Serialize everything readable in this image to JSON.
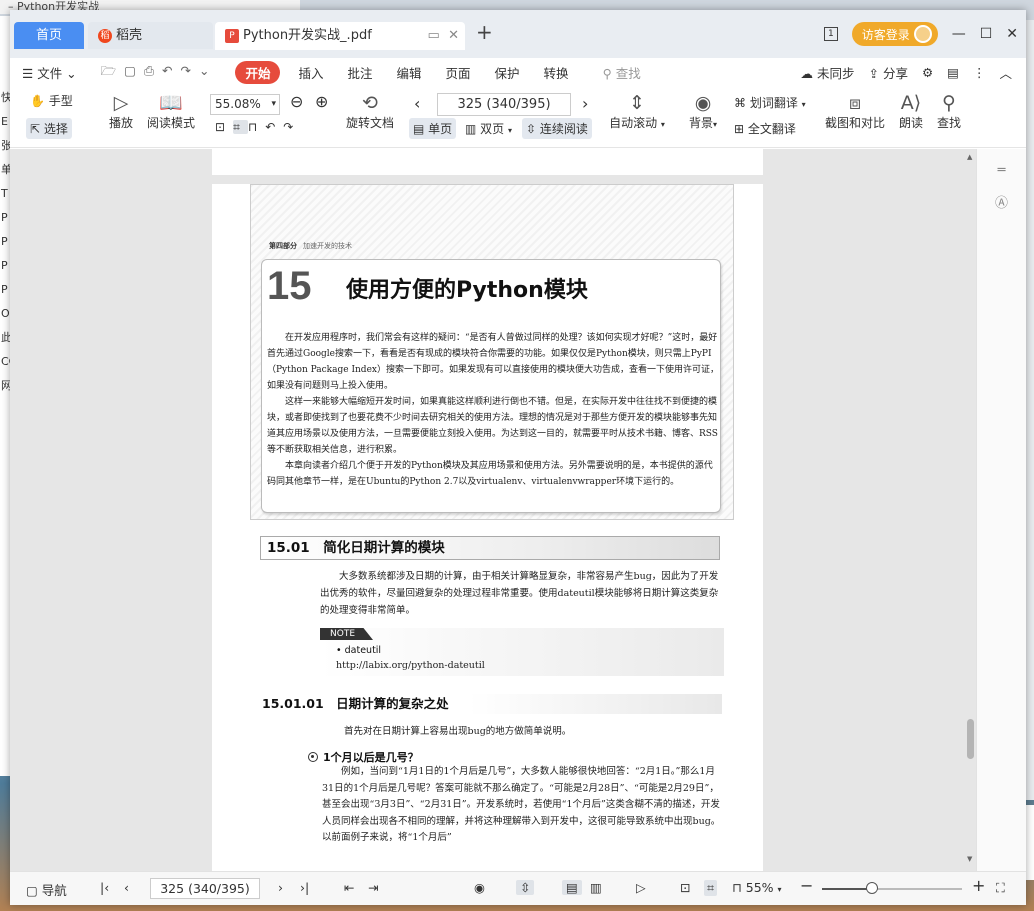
{
  "desktop": {
    "behind_title": "– Python开发实战",
    "behind_strip": [
      "快",
      "E",
      "张",
      "单",
      "T",
      "P",
      "P",
      "P",
      "P",
      "Or",
      "此",
      "CC",
      "网"
    ],
    "right_more": "···"
  },
  "tabs": {
    "home": "首页",
    "daoke": "稻壳",
    "pdf": "Python开发实战_.pdf",
    "add": "+"
  },
  "titlebar": {
    "page_indicator": "1",
    "login": "访客登录",
    "minimize": "—",
    "maximize": "☐",
    "close": "✕"
  },
  "menu": {
    "file": "文件",
    "start": "开始",
    "insert": "插入",
    "annotate": "批注",
    "edit": "编辑",
    "page": "页面",
    "protect": "保护",
    "convert": "转换",
    "search": "查找",
    "sync": "未同步",
    "share": "分享"
  },
  "ribbon": {
    "hand": "手型",
    "select": "选择",
    "play": "播放",
    "read_mode": "阅读模式",
    "zoom": "55.08%",
    "rotate": "旋转文档",
    "page_box": "325 (340/395)",
    "single": "单页",
    "double": "双页",
    "continuous": "连续阅读",
    "auto_scroll": "自动滚动",
    "background": "背景",
    "word_translate": "划词翻译",
    "full_translate": "全文翻译",
    "crop_compare": "截图和对比",
    "read_aloud": "朗读",
    "find": "查找"
  },
  "document": {
    "part_label": "第四部分",
    "part_subtitle": "加速开发的技术",
    "chapter_number": "15",
    "chapter_title": "使用方便的Python模块",
    "intro_p1": "在开发应用程序时，我们常会有这样的疑问：“是否有人曾做过同样的处理？该如何实现才好呢？”这时，最好首先通过Google搜索一下，看看是否有现成的模块符合你需要的功能。如果仅仅是Python模块，则只需上PyPI（Python Package Index）搜索一下即可。如果发现有可以直接使用的模块便大功告成，查看一下使用许可证，如果没有问题则马上投入使用。",
    "intro_p2": "这样一来能够大幅缩短开发时间，如果真能这样顺利进行倒也不错。但是，在实际开发中往往找不到便捷的模块，或者即使找到了也要花费不少时间去研究相关的使用方法。理想的情况是对于那些方便开发的模块能够事先知道其应用场景以及使用方法，一旦需要便能立刻投入使用。为达到这一目的，就需要平时从技术书籍、博客、RSS等不断获取相关信息，进行积累。",
    "intro_p3": "本章向读者介绍几个便于开发的Python模块及其应用场景和使用方法。另外需要说明的是，本书提供的源代码同其他章节一样，是在Ubuntu的Python 2.7以及virtualenv、virtualenvwrapper环境下运行的。",
    "section_title": "15.01　简化日期计算的模块",
    "section_body": "大多数系统都涉及日期的计算，由于相关计算略显复杂，非常容易产生bug，因此为了开发出优秀的软件，尽量回避复杂的处理过程非常重要。使用dateutil模块能够将日期计算这类复杂的处理变得非常简单。",
    "note_tag": "NOTE",
    "note_item": "• dateutil",
    "note_url": "http://labix.org/python-dateutil",
    "subsection_title": "15.01.01　日期计算的复杂之处",
    "subsection_body": "首先对在日期计算上容易出现bug的地方做简单说明。",
    "bullet_title": "1个月以后是几号？",
    "bullet_body": "例如，当问到“1月1日的1个月后是几号”，大多数人能够很快地回答：“2月1日。”那么1月31日的1个月后是几号呢？答案可能就不那么确定了。“可能是2月28日”、“可能是2月29日”，甚至会出现“3月3日”、“2月31日”。开发系统时，若使用“1个月后”这类含糊不清的描述，开发人员同样会出现各不相同的理解，并将这种理解带入到开发中，这很可能导致系统中出现bug。以前面例子来说，将“1个月后”"
  },
  "statusbar": {
    "nav": "导航",
    "page": "325 (340/395)",
    "zoom": "55%"
  }
}
